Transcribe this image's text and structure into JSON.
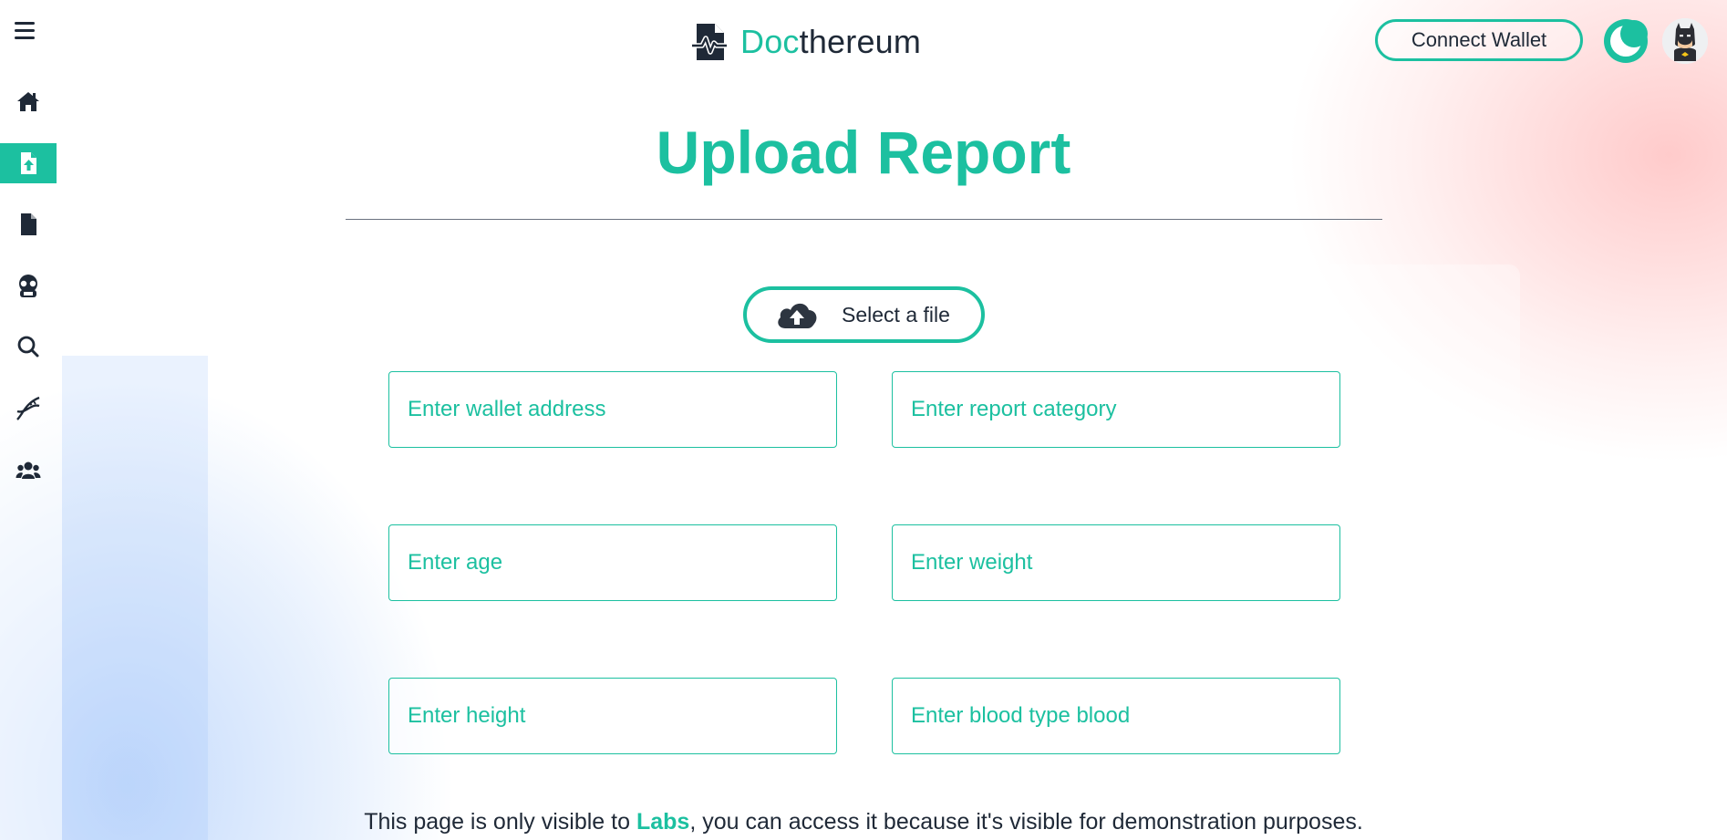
{
  "header": {
    "logo_accent": "Doc",
    "logo_rest": "thereum",
    "connect_label": "Connect Wallet"
  },
  "sidebar": {
    "items": [
      {
        "icon": "home-icon"
      },
      {
        "icon": "file-upload-icon",
        "active": true
      },
      {
        "icon": "file-icon"
      },
      {
        "icon": "doctor-icon"
      },
      {
        "icon": "search-icon"
      },
      {
        "icon": "dna-icon"
      },
      {
        "icon": "users-icon"
      }
    ]
  },
  "main": {
    "title": "Upload Report",
    "file_button_label": "Select a file",
    "fields": {
      "wallet": "Enter wallet address",
      "category": "Enter report category",
      "age": "Enter age",
      "weight": "Enter weight",
      "height": "Enter height",
      "blood": "Enter blood type blood"
    }
  },
  "footer": {
    "before": "This page is only visible to ",
    "labs": "Labs",
    "after": ", you can access it because it's visible for demonstration purposes."
  },
  "colors": {
    "accent": "#1cc0a0",
    "text": "#1f2937"
  }
}
